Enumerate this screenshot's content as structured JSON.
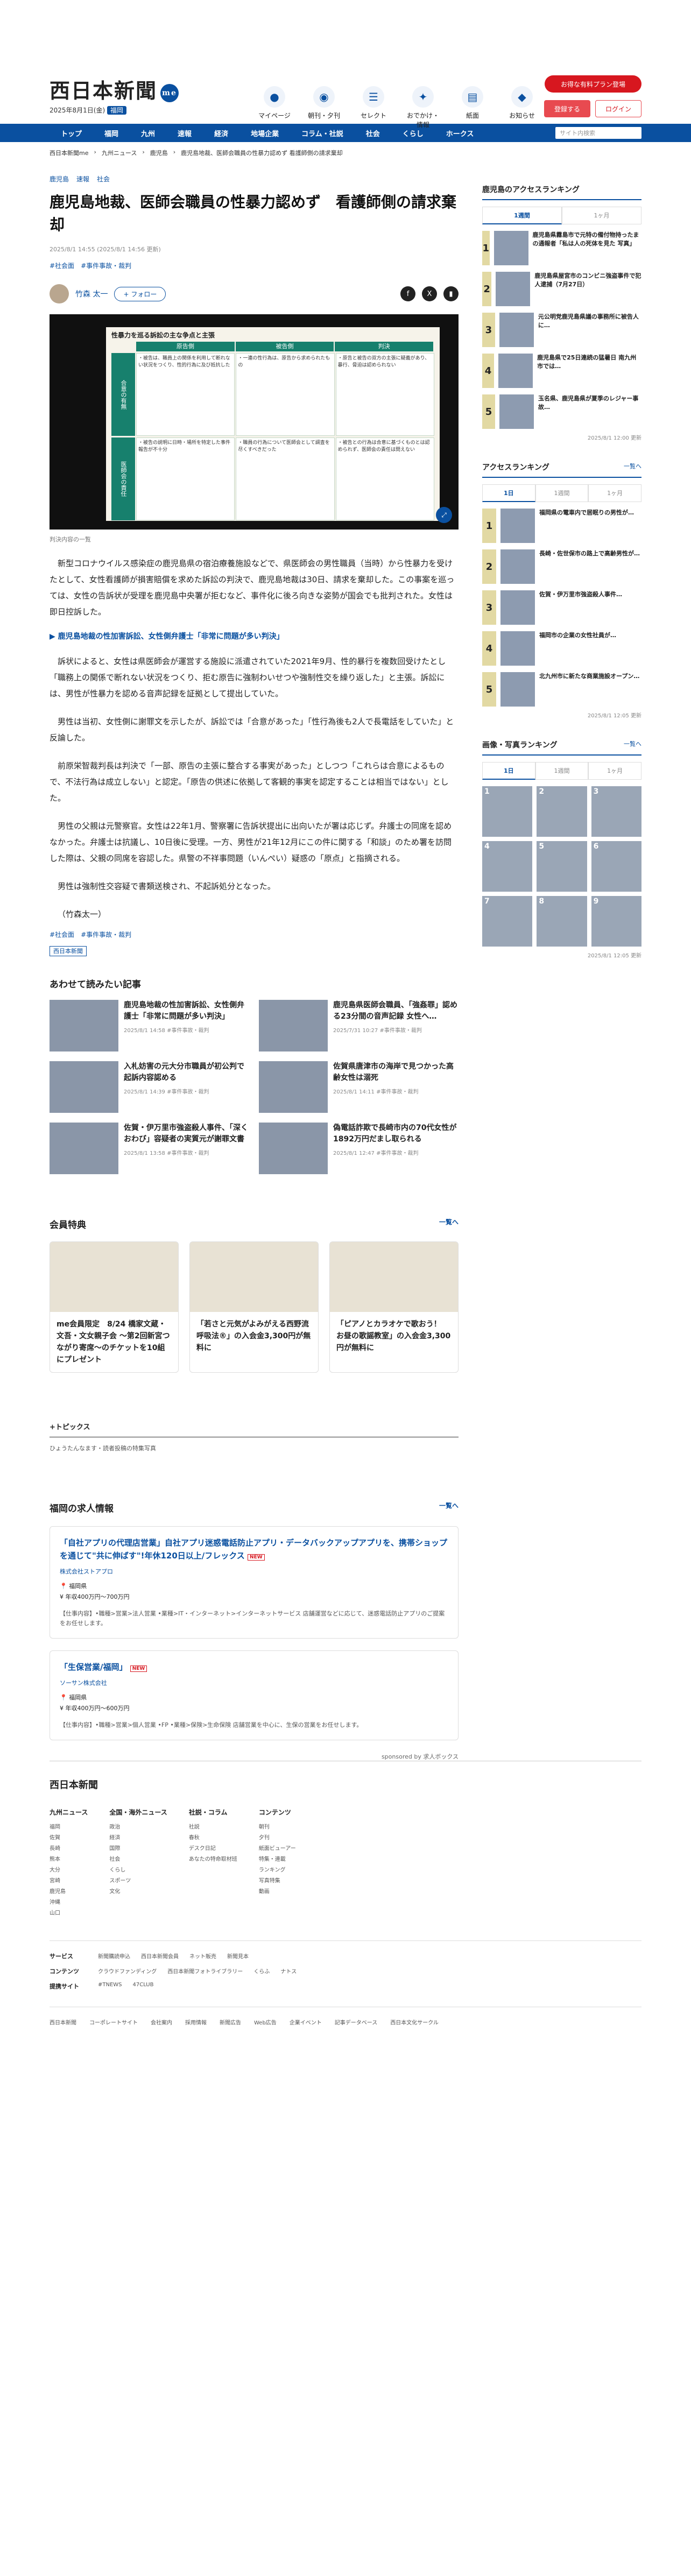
{
  "header": {
    "logo": "西日本新聞",
    "logo_badge": "me",
    "date": "2025年8月1日(金)",
    "date_badge": "福岡",
    "icons": [
      {
        "icon": "me-icon",
        "label": "マイページ"
      },
      {
        "icon": "newspaper-icon",
        "label": "朝刊・夕刊"
      },
      {
        "icon": "select-icon",
        "label": "セレクト"
      },
      {
        "icon": "footsteps-icon",
        "label": "おでかけ・情報"
      },
      {
        "icon": "paper-icon",
        "label": "紙面"
      },
      {
        "icon": "bell-icon",
        "label": "お知らせ"
      }
    ],
    "promo_button": "お得な有料プラン登場",
    "register_button": "登録する",
    "login_button": "ログイン"
  },
  "nav": {
    "items": [
      "トップ",
      "福岡",
      "九州",
      "速報",
      "経済",
      "地場企業",
      "コラム・社説",
      "社会",
      "くらし",
      "ホークス"
    ],
    "search_placeholder": "サイト内検索"
  },
  "breadcrumb": [
    "西日本新聞me",
    "九州ニュース",
    "鹿児島",
    "鹿児島地裁、医師会職員の性暴力認めず 看護師側の請求棄却"
  ],
  "article": {
    "categories": [
      "鹿児島",
      "速報",
      "社会"
    ],
    "title": "鹿児島地裁、医師会職員の性暴力認めず　看護師側の請求棄却",
    "dates": "2025/8/1 14:55 (2025/8/1 14:56 更新)",
    "tags": [
      "#社会面",
      "#事件事故・裁判"
    ],
    "author": "竹森 太一",
    "follow": "+ フォロー",
    "photo_caption": "判決内容の一覧",
    "board": {
      "title": "性暴力を巡る訴訟の主な争点と主張",
      "headers": [
        "原告側",
        "被告側",
        "判決"
      ],
      "rows": [
        {
          "label": "合意の有無",
          "cells": [
            "・被告は、職員上の関係を利用して断れない状況をつくり、性的行為に及び抵抗した",
            "・一連の性行為は、原告から求められたもの",
            "・原告と被告の双方の主張に疑義があり、暴行、脅迫は認められない"
          ]
        },
        {
          "label": "医師会の責任",
          "cells": [
            "・被告の説明に日時・場所を特定した事件報告が不十分",
            "・職員の行為について医師会として調査を尽くすべきだった",
            "・被告との行為は合意に基づくものとは認められず、医師会の責任は問えない"
          ]
        }
      ]
    },
    "paragraphs": [
      "新型コロナウイルス感染症の鹿児島県の宿泊療養施設などで、県医師会の男性職員（当時）から性暴力を受けたとして、女性看護師が損害賠償を求めた訴訟の判決で、鹿児島地裁は30日、請求を棄却した。この事案を巡っては、女性の告訴状が受理を鹿児島中央署が拒むなど、事件化に後ろ向きな姿勢が国会でも批判された。女性は即日控訴した。",
      "訴状によると、女性は県医師会が運営する施設に派遣されていた2021年9月、性的暴行を複数回受けたとし「職務上の関係で断れない状況をつくり、拒む原告に強制わいせつや強制性交を繰り返した」と主張。訴訟には、男性が性暴力を認める音声記録を証拠として提出していた。",
      "男性は当初、女性側に謝罪文を示したが、訴訟では「合意があった」「性行為後も2人で長電話をしていた」と反論した。",
      "前原栄智裁判長は判決で「一部、原告の主張に整合する事実があった」としつつ「これらは合意によるもので、不法行為は成立しない」と認定。「原告の供述に依拠して客観的事実を認定することは相当ではない」とした。",
      "男性の父親は元警察官。女性は22年1月、警察署に告訴状提出に出向いたが署は応じず。弁護士の同席を認めなかった。弁護士は抗議し、10日後に受理。一方、男性が21年12月にこの件に関する「和談」のため署を訪問した際は、父親の同席を容認した。県警の不祥事問題（いんぺい）疑惑の「原点」と指摘される。",
      "男性は強制性交容疑で書類送検され、不起訴処分となった。",
      "（竹森太一）"
    ],
    "related_link": "鹿児島地裁の性加害訴訟、女性側弁護士「非常に問題が多い判決」",
    "bottom_tags": [
      "#社会面",
      "#事件事故・裁判"
    ],
    "paper_badge": "西日本新聞"
  },
  "related": {
    "heading": "あわせて読みたい記事",
    "items": [
      {
        "title": "鹿児島地裁の性加害訴訟、女性側弁護士「非常に問題が多い判決」",
        "meta": "2025/8/1 14:58  #事件事故・裁判"
      },
      {
        "title": "鹿児島県医師会職員、「強姦罪」認める23分間の音声記録 女性へ…",
        "meta": "2025/7/31 10:27  #事件事故・裁判"
      },
      {
        "title": "入札妨害の元大分市職員が初公判で起訴内容認める",
        "meta": "2025/8/1 14:39  #事件事故・裁判"
      },
      {
        "title": "佐賀県唐津市の海岸で見つかった高齢女性は溺死",
        "meta": "2025/8/1 14:11  #事件事故・裁判"
      },
      {
        "title": "佐賀・伊万里市強盗殺人事件、「深くおわび」容疑者の実質元が謝罪文書",
        "meta": "2025/8/1 13:58  #事件事故・裁判"
      },
      {
        "title": "偽電話詐欺で長崎市内の70代女性が1892万円だまし取られる",
        "meta": "2025/8/1 12:47  #事件事故・裁判"
      }
    ]
  },
  "members": {
    "heading": "会員特典",
    "more": "一覧へ",
    "items": [
      {
        "title": "me会員限定　8/24 橋家文蔵・文吾・文女親子会 ～第2回新宮つながり寄席～のチケットを10組にプレゼント"
      },
      {
        "title": "「若さと元気がよみがえる西野流呼吸法®」の入会金3,300円が無料に"
      },
      {
        "title": "「ピアノとカラオケで歌おう！　お昼の歌謡教室」の入会金3,300円が無料に"
      }
    ]
  },
  "topics": {
    "heading": "+トピックス",
    "items": [
      "ひょうたんなます・読者投稿の特集写真"
    ]
  },
  "jobs": {
    "heading": "福岡の求人情報",
    "more": "一覧へ",
    "items": [
      {
        "title": "「自社アプリの代理店営業」自社アプリ迷惑電話防止アプリ・データバックアップアプリを、携帯ショップを通じて\"共に伸ばす\"!年休120日以上/フレックス",
        "badge": "NEW",
        "company": "株式会社ストアプロ",
        "location": "福岡県",
        "salary": "年収400万円〜700万円",
        "desc": "【仕事内容】•職種>営業>法人営業 •業種>IT・インターネット>インターネットサービス 店舗運営などに応じて、迷惑電話防止アプリのご提案をお任せします。"
      },
      {
        "title": "「生保営業/福岡」",
        "badge": "NEW",
        "company": "ソーサン株式会社",
        "location": "福岡県",
        "salary": "年収400万円〜600万円",
        "desc": "【仕事内容】•職種>営業>個人営業 •FP •業種>保険>生命保険 店舗営業を中心に、生保の営業をお任せします。"
      }
    ],
    "powered": "sponsored by 求人ボックス"
  },
  "sidebar": {
    "access_ranking_title": "鹿児島のアクセスランキング",
    "tabs1": [
      "1週間",
      "1ヶ月"
    ],
    "rank1": [
      {
        "n": "1",
        "title": "鹿児島県霧島市で元特の備付物持ったまの通報者「私は人の死体を見た 写真」"
      },
      {
        "n": "2",
        "title": "鹿児島県屋宮市のコンビニ強盗事件で犯人逮捕（7月27日）"
      },
      {
        "n": "3",
        "title": "元公明党鹿児島県議の事務所に被告人に…"
      },
      {
        "n": "4",
        "title": "鹿児島県で25日連続の猛暑日 南九州市では…"
      },
      {
        "n": "5",
        "title": "玉名県、鹿児島県が夏季のレジャー事故…"
      }
    ],
    "rank1_date": "2025/8/1 12:00 更新",
    "access_title": "アクセスランキング",
    "access_more": "一覧へ",
    "tabs2": [
      "1日",
      "1週間",
      "1ヶ月"
    ],
    "rank2": [
      {
        "n": "1",
        "title": "福岡県の電車内で居眠りの男性が…"
      },
      {
        "n": "2",
        "title": "長崎・佐世保市の路上で高齢男性が…"
      },
      {
        "n": "3",
        "title": "佐賀・伊万里市強盗殺人事件…"
      },
      {
        "n": "4",
        "title": "福岡市の企業の女性社員が…"
      },
      {
        "n": "5",
        "title": "北九州市に新たな商業施設オープン…"
      }
    ],
    "rank2_date": "2025/8/1 12:05 更新",
    "photo_title": "画像・写真ランキング",
    "photo_more": "一覧へ",
    "tabs3": [
      "1日",
      "1週間",
      "1ヶ月"
    ],
    "photo_numbers": [
      "1",
      "2",
      "3",
      "4",
      "5",
      "6",
      "7",
      "8",
      "9"
    ],
    "photo_date": "2025/8/1 12:05 更新"
  },
  "footer": {
    "logo": "西日本新聞",
    "columns": [
      {
        "heading": "九州ニュース",
        "items": [
          "福岡",
          "佐賀",
          "長崎",
          "熊本",
          "大分",
          "宮崎",
          "鹿児島",
          "沖縄",
          "山口"
        ]
      },
      {
        "heading": "全国・海外ニュース",
        "items": [
          "政治",
          "経済",
          "国際",
          "社会",
          "くらし",
          "スポーツ",
          "文化"
        ]
      },
      {
        "heading": "社説・コラム",
        "items": [
          "社説",
          "春秋",
          "デスク日記",
          "あなたの特命取材班"
        ]
      },
      {
        "heading": "コンテンツ",
        "items": [
          "朝刊",
          "夕刊",
          "紙面ビューアー",
          "特集・連載",
          "ランキング",
          "写真特集",
          "動画"
        ]
      }
    ],
    "rows": [
      {
        "label": "サービス",
        "items": [
          "新聞購読申込",
          "西日本新聞会員",
          "ネット販売",
          "新聞見本"
        ]
      },
      {
        "label": "コンテンツ",
        "items": [
          "クラウドファンディング",
          "西日本新聞フォトライブラリー",
          "くらふ",
          "ナトス"
        ]
      },
      {
        "label": "提携サイト",
        "items": [
          "#TNEWS",
          "47CLUB"
        ]
      }
    ],
    "bottom": [
      "西日本新聞",
      "コーポレートサイト",
      "会社案内",
      "採用情報",
      "新聞広告",
      "Web広告",
      "企業イベント",
      "記事データベース",
      "西日本文化サークル"
    ]
  }
}
